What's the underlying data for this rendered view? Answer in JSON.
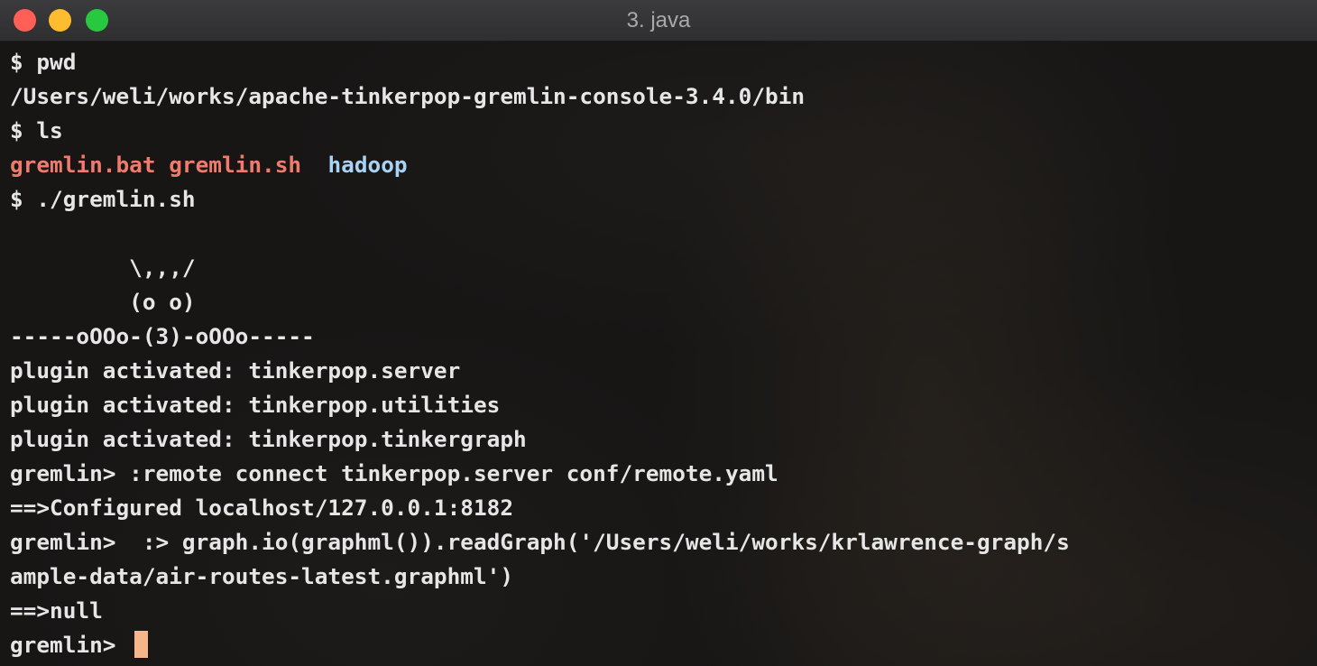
{
  "window": {
    "title": "3. java"
  },
  "terminal": {
    "lines": [
      "$ pwd",
      "/Users/weli/works/apache-tinkerpop-gremlin-console-3.4.0/bin",
      "$ ls",
      "",
      "$ ./gremlin.sh",
      "",
      "         \\,,,/",
      "         (o o)",
      "-----oOOo-(3)-oOOo-----",
      "plugin activated: tinkerpop.server",
      "plugin activated: tinkerpop.utilities",
      "plugin activated: tinkerpop.tinkergraph",
      "gremlin> :remote connect tinkerpop.server conf/remote.yaml",
      "==>Configured localhost/127.0.0.1:8182",
      "gremlin>  :> graph.io(graphml()).readGraph('/Users/weli/works/krlawrence-graph/s",
      "ample-data/air-routes-latest.graphml')",
      "==>null",
      "gremlin> "
    ],
    "ls_output": [
      {
        "name": "gremlin.bat",
        "color": "#ee7b6c"
      },
      {
        "name": "gremlin.sh",
        "color": "#ee7b6c"
      },
      {
        "name": "hadoop",
        "color": "#a9d3f5"
      }
    ],
    "colors": {
      "background": "#171615",
      "foreground": "#e6e6e6",
      "cursor": "#f5b78a"
    }
  }
}
